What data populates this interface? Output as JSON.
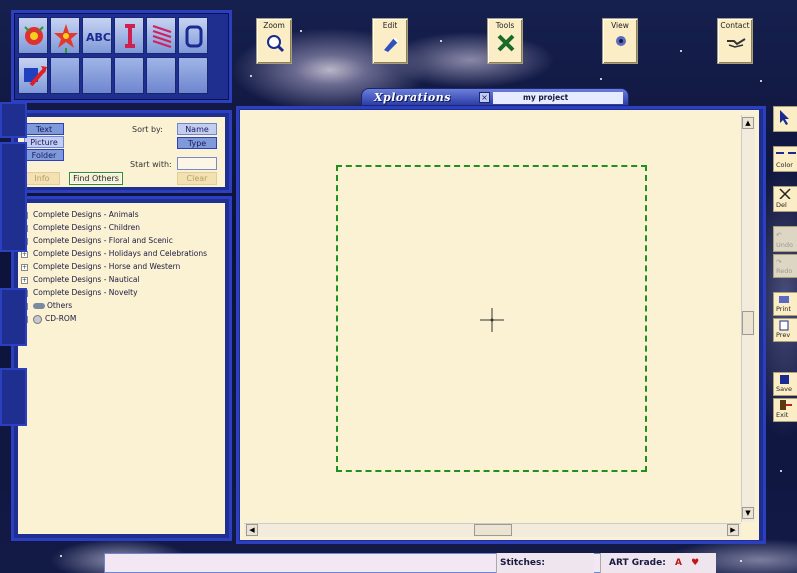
{
  "app": {
    "brand": "Xplorations",
    "project_name": "my project"
  },
  "toolbar": {
    "zoom_label": "Zoom",
    "edit_label": "Edit",
    "tools_label": "Tools",
    "view_label": "View",
    "contact_label": "Contact"
  },
  "search_panel": {
    "text_option": "Text",
    "picture_option": "Picture",
    "folder_option": "Folder",
    "sort_by_label": "Sort by:",
    "sort_name": "Name",
    "sort_type": "Type",
    "start_with_label": "Start with:",
    "info_button": "Info",
    "find_others_button": "Find Others",
    "clear_button": "Clear"
  },
  "tree": {
    "items": [
      "Complete Designs - Animals",
      "Complete Designs - Children",
      "Complete Designs - Floral and Scenic",
      "Complete Designs - Holidays and Celebrations",
      "Complete Designs - Horse and Western",
      "Complete Designs - Nautical",
      "Complete Designs - Novelty",
      "Others",
      "CD-ROM"
    ]
  },
  "right_toolbar": {
    "color_label": "Color",
    "delete_label": "Del",
    "undo_label": "Undo",
    "redo_label": "Redo",
    "print_label": "Print",
    "preview_label": "Prev",
    "save_label": "Save",
    "exit_label": "Exit"
  },
  "status": {
    "stitches_label": "Stitches:",
    "art_grade_label": "ART Grade:",
    "art_grade_value": "A"
  },
  "colors": {
    "hoop": "#1f8f1f",
    "panel_border": "#2b3fc0",
    "canvas_bg": "#fbf1d3"
  }
}
